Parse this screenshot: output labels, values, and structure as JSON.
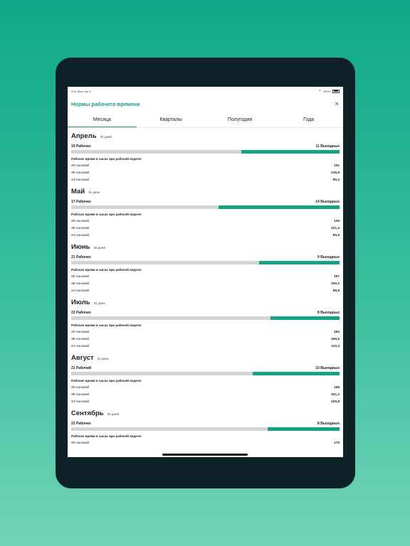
{
  "statusbar": {
    "time": "9:41",
    "date": "Mon Jun 3",
    "battery": "100%"
  },
  "header": {
    "title": "Нормы рабочего времени",
    "close_icon": "close-icon"
  },
  "tabs": [
    {
      "label": "Месяца",
      "active": true
    },
    {
      "label": "Кварталы",
      "active": false
    },
    {
      "label": "Полугодия",
      "active": false
    },
    {
      "label": "Года",
      "active": false
    }
  ],
  "colors": {
    "accent": "#14a384",
    "bar_bg": "#d4d4d4"
  },
  "months": [
    {
      "name": "Апрель",
      "days": "30 дней",
      "work": "19 Рабочих",
      "off": "11 Выходных",
      "off_fraction": 0.367,
      "hours_title": "Рабочее время в часах при рабочей неделе:",
      "rows": [
        {
          "label": "40-часовой",
          "value": "151"
        },
        {
          "label": "36-часовой",
          "value": "135,8"
        },
        {
          "label": "24-часовой",
          "value": "90,2"
        }
      ]
    },
    {
      "name": "Май",
      "days": "31 день",
      "work": "17 Рабочих",
      "off": "14 Выходных",
      "off_fraction": 0.452,
      "hours_title": "Рабочее время в часах при рабочей неделе:",
      "rows": [
        {
          "label": "40-часовой",
          "value": "135"
        },
        {
          "label": "36-часовой",
          "value": "121,4"
        },
        {
          "label": "24-часовой",
          "value": "80,6"
        }
      ]
    },
    {
      "name": "Июнь",
      "days": "30 дней",
      "work": "21 Рабочих",
      "off": "9 Выходных",
      "off_fraction": 0.3,
      "hours_title": "Рабочее время в часах при рабочей неделе:",
      "rows": [
        {
          "label": "40-часовой",
          "value": "167"
        },
        {
          "label": "36-часовой",
          "value": "150,2"
        },
        {
          "label": "24-часовой",
          "value": "99,8"
        }
      ]
    },
    {
      "name": "Июль",
      "days": "31 день",
      "work": "23 Рабочих",
      "off": "8 Выходных",
      "off_fraction": 0.258,
      "hours_title": "Рабочее время в часах при рабочей неделе:",
      "rows": [
        {
          "label": "40-часовой",
          "value": "184"
        },
        {
          "label": "36-часовой",
          "value": "165,6"
        },
        {
          "label": "24-часовой",
          "value": "110,4"
        }
      ]
    },
    {
      "name": "Август",
      "days": "31 день",
      "work": "21 Рабочий",
      "off": "10 Выходных",
      "off_fraction": 0.323,
      "hours_title": "Рабочее время в часах при рабочей неделе:",
      "rows": [
        {
          "label": "40-часовой",
          "value": "168"
        },
        {
          "label": "36-часовой",
          "value": "151,2"
        },
        {
          "label": "24-часовой",
          "value": "100,8"
        }
      ]
    },
    {
      "name": "Сентябрь",
      "days": "30 дней",
      "work": "22 Рабочих",
      "off": "8 Выходных",
      "off_fraction": 0.267,
      "hours_title": "Рабочее время в часах при рабочей неделе:",
      "rows": [
        {
          "label": "40-часовой",
          "value": "176"
        }
      ]
    }
  ]
}
